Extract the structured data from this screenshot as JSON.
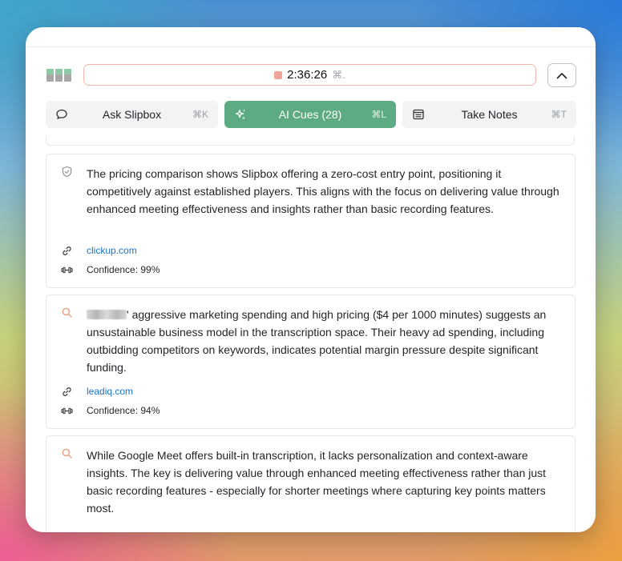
{
  "timer": {
    "time": "2:36:26",
    "shortcut": "⌘."
  },
  "tabs": [
    {
      "label": "Ask Slipbox",
      "shortcut": "⌘K",
      "icon": "chat-bubble-icon",
      "active": false
    },
    {
      "label": "AI Cues (28)",
      "shortcut": "⌘L",
      "icon": "sparkle-icon",
      "active": true
    },
    {
      "label": "Take Notes",
      "shortcut": "⌘T",
      "icon": "notes-icon",
      "active": false
    }
  ],
  "cards": [
    {
      "icon": "shield-check-icon",
      "text": "The pricing comparison shows Slipbox offering a zero-cost entry point, positioning it competitively against established players. This aligns with the focus on delivering value through enhanced meeting effectiveness and insights rather than basic recording features.",
      "source": "clickup.com",
      "confidence": "Confidence: 99%"
    },
    {
      "icon": "search-icon",
      "text_suffix": "' aggressive marketing spending and high pricing ($4 per 1000 minutes) suggests an unsustainable business model in the transcription space. Their heavy ad spending, including outbidding competitors on keywords, indicates potential margin pressure despite significant funding.",
      "source": "leadiq.com",
      "confidence": "Confidence: 94%"
    },
    {
      "icon": "search-icon",
      "text": "While Google Meet offers built-in transcription, it lacks personalization and context-aware insights. The key is delivering value through enhanced meeting effectiveness rather than just basic recording features - especially for shorter meetings where capturing key points matters most."
    }
  ],
  "colors": {
    "accent_green": "#5dab82",
    "link_blue": "#1a73c8",
    "record_red": "#f0a49a",
    "search_icon_orange": "#eb9a7a"
  }
}
